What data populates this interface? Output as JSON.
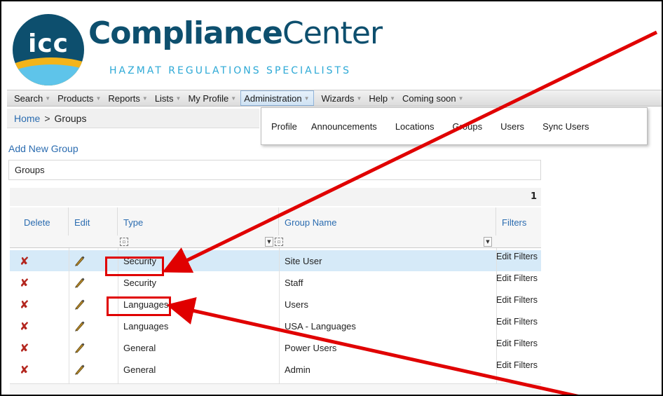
{
  "logo": {
    "icon_text": "icc",
    "brand_bold": "Compliance",
    "brand_light": "Center",
    "tagline": "HAZMAT  REGULATIONS SPECIALISTS"
  },
  "menu": {
    "items": [
      "Search",
      "Products",
      "Reports",
      "Lists",
      "My Profile",
      "Administration",
      "Wizards",
      "Help",
      "Coming soon"
    ],
    "active": "Administration"
  },
  "dropdown": {
    "items": [
      "Profile",
      "Announcements",
      "Locations",
      "Groups",
      "Users",
      "Sync Users"
    ]
  },
  "breadcrumb": {
    "home": "Home",
    "separator": ">",
    "current": "Groups"
  },
  "add_new_group": "Add New Group",
  "panel_title": "Groups",
  "pager": {
    "page": "1"
  },
  "grid": {
    "columns": {
      "delete": "Delete",
      "edit": "Edit",
      "type": "Type",
      "group_name": "Group Name",
      "filters": "Filters"
    },
    "rows": [
      {
        "type": "Security",
        "group_name": "Site User",
        "filters": "Edit Filters",
        "selected": true
      },
      {
        "type": "Security",
        "group_name": "Staff",
        "filters": "Edit Filters",
        "selected": false
      },
      {
        "type": "Languages",
        "group_name": "Users",
        "filters": "Edit Filters",
        "selected": false
      },
      {
        "type": "Languages",
        "group_name": "USA - Languages",
        "filters": "Edit Filters",
        "selected": false
      },
      {
        "type": "General",
        "group_name": "Power Users",
        "filters": "Edit Filters",
        "selected": false
      },
      {
        "type": "General",
        "group_name": "Admin",
        "filters": "Edit Filters",
        "selected": false
      }
    ]
  },
  "colors": {
    "brand_navy": "#0d4f6e",
    "brand_cyan": "#2da9d6",
    "link_blue": "#2b6cb0",
    "delete_red": "#b3261e",
    "annotation_red": "#e00000",
    "selected_row": "#d6eaf8"
  }
}
